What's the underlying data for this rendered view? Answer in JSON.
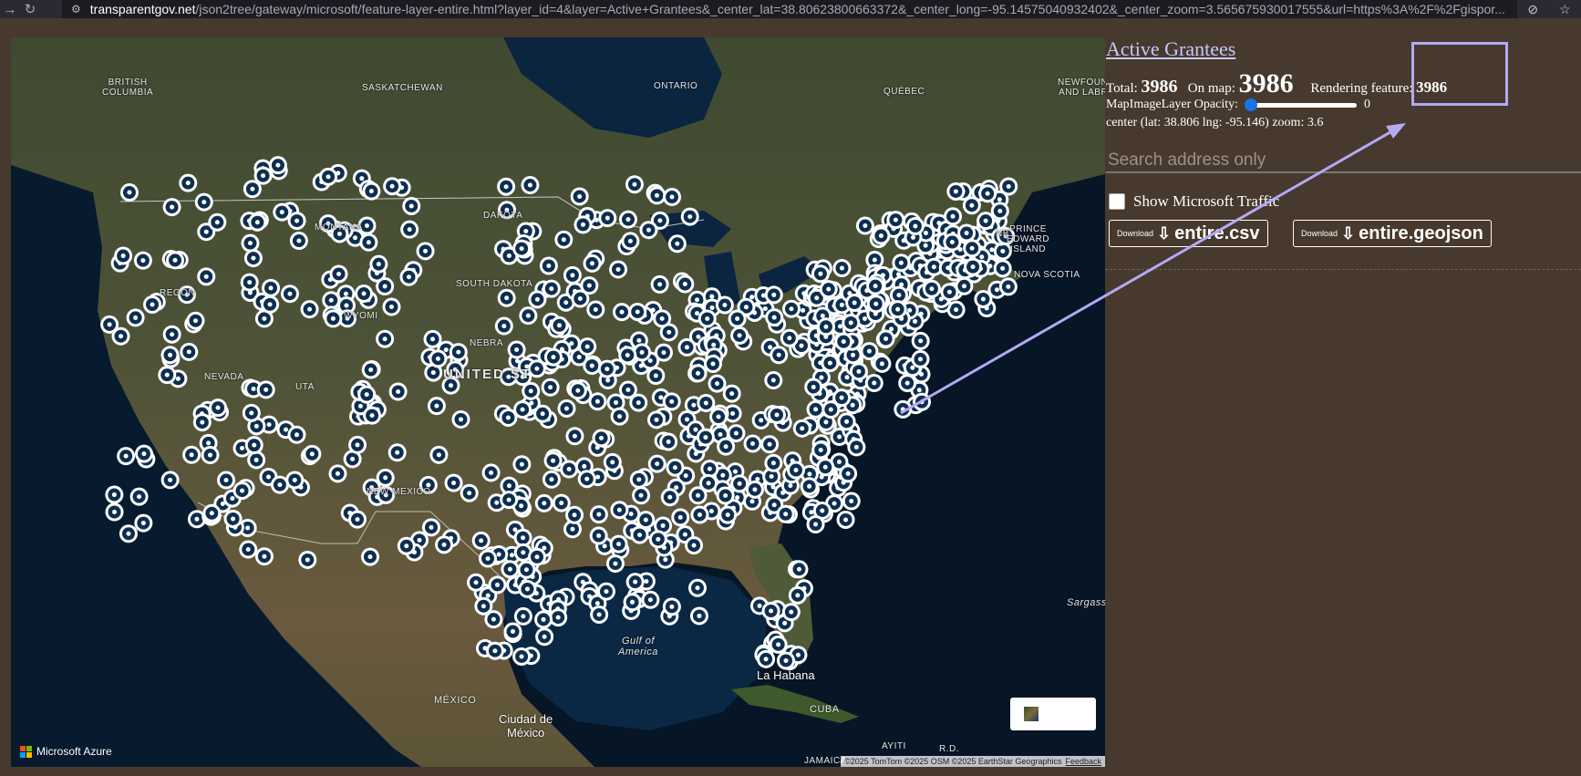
{
  "browser": {
    "url_host": "transparentgov.net",
    "url_path": "/json2tree/gateway/microsoft/feature-layer-entire.html?layer_id=4&layer=Active+Grantees&_center_lat=38.80623800663372&_center_long=-95.14575040932402&_center_zoom=3.565675930017555&url=https%3A%2F%2Fgispor..."
  },
  "map": {
    "labels": {
      "british_columbia": "BRITISH\nCOLUMBIA",
      "saskatchewan": "SASKATCHEWAN",
      "ontario": "ONTARIO",
      "quebec": "QUÉBEC",
      "newfoundland": "NEWFOUN\nAND LABR",
      "montana": "MONTANA",
      "dakota": "DAKOTA",
      "south_dakota": "SOUTH DAKOTA",
      "oregon": "REGON",
      "wyoming": "WYOMI",
      "nebraska": "NEBRA",
      "nevada": "NEVADA",
      "united_states": "UNITED ST",
      "utah": "UTA",
      "new_mexico": "NEW MEXICO",
      "nb": "NB",
      "pei": "PRINCE\nEDWARD\nISLAND",
      "nova_scotia": "NOVA SCOTIA",
      "gulf_of_mexico": "Gulf of\nAmerica",
      "mexico": "MÉXICO",
      "la_habana": "La Habana",
      "cuba": "CUBA",
      "ciudad_de_mexico": "Ciudad de\nMéxico",
      "sargasso": "Sargasso",
      "haiti": "AYITI",
      "jamaica": "JAMAICA",
      "dr": "R.D."
    },
    "logo_text": "Microsoft Azure",
    "copyright": "©2025 TomTom  ©2025 OSM  ©2025 EarthStar Geographics",
    "feedback": "Feedback",
    "marker_color": "#0d2e4f"
  },
  "panel": {
    "layer_title": "Active Grantees",
    "total_label": "Total:",
    "total_value": "3986",
    "onmap_label": "On map:",
    "onmap_value": "3986",
    "rendering_label": "Rendering feature:",
    "rendering_value": "3986",
    "opacity_label": "MapImageLayer Opacity:",
    "opacity_value": "0",
    "center_text": "center (lat: 38.806 lng: -95.146) zoom: 3.6",
    "search_placeholder": "Search address only",
    "traffic_label": "Show Microsoft Traffic",
    "download_small": "Download",
    "download_csv": "entire.csv",
    "download_geojson": "entire.geojson"
  },
  "annotation_color": "#b4a9f5"
}
